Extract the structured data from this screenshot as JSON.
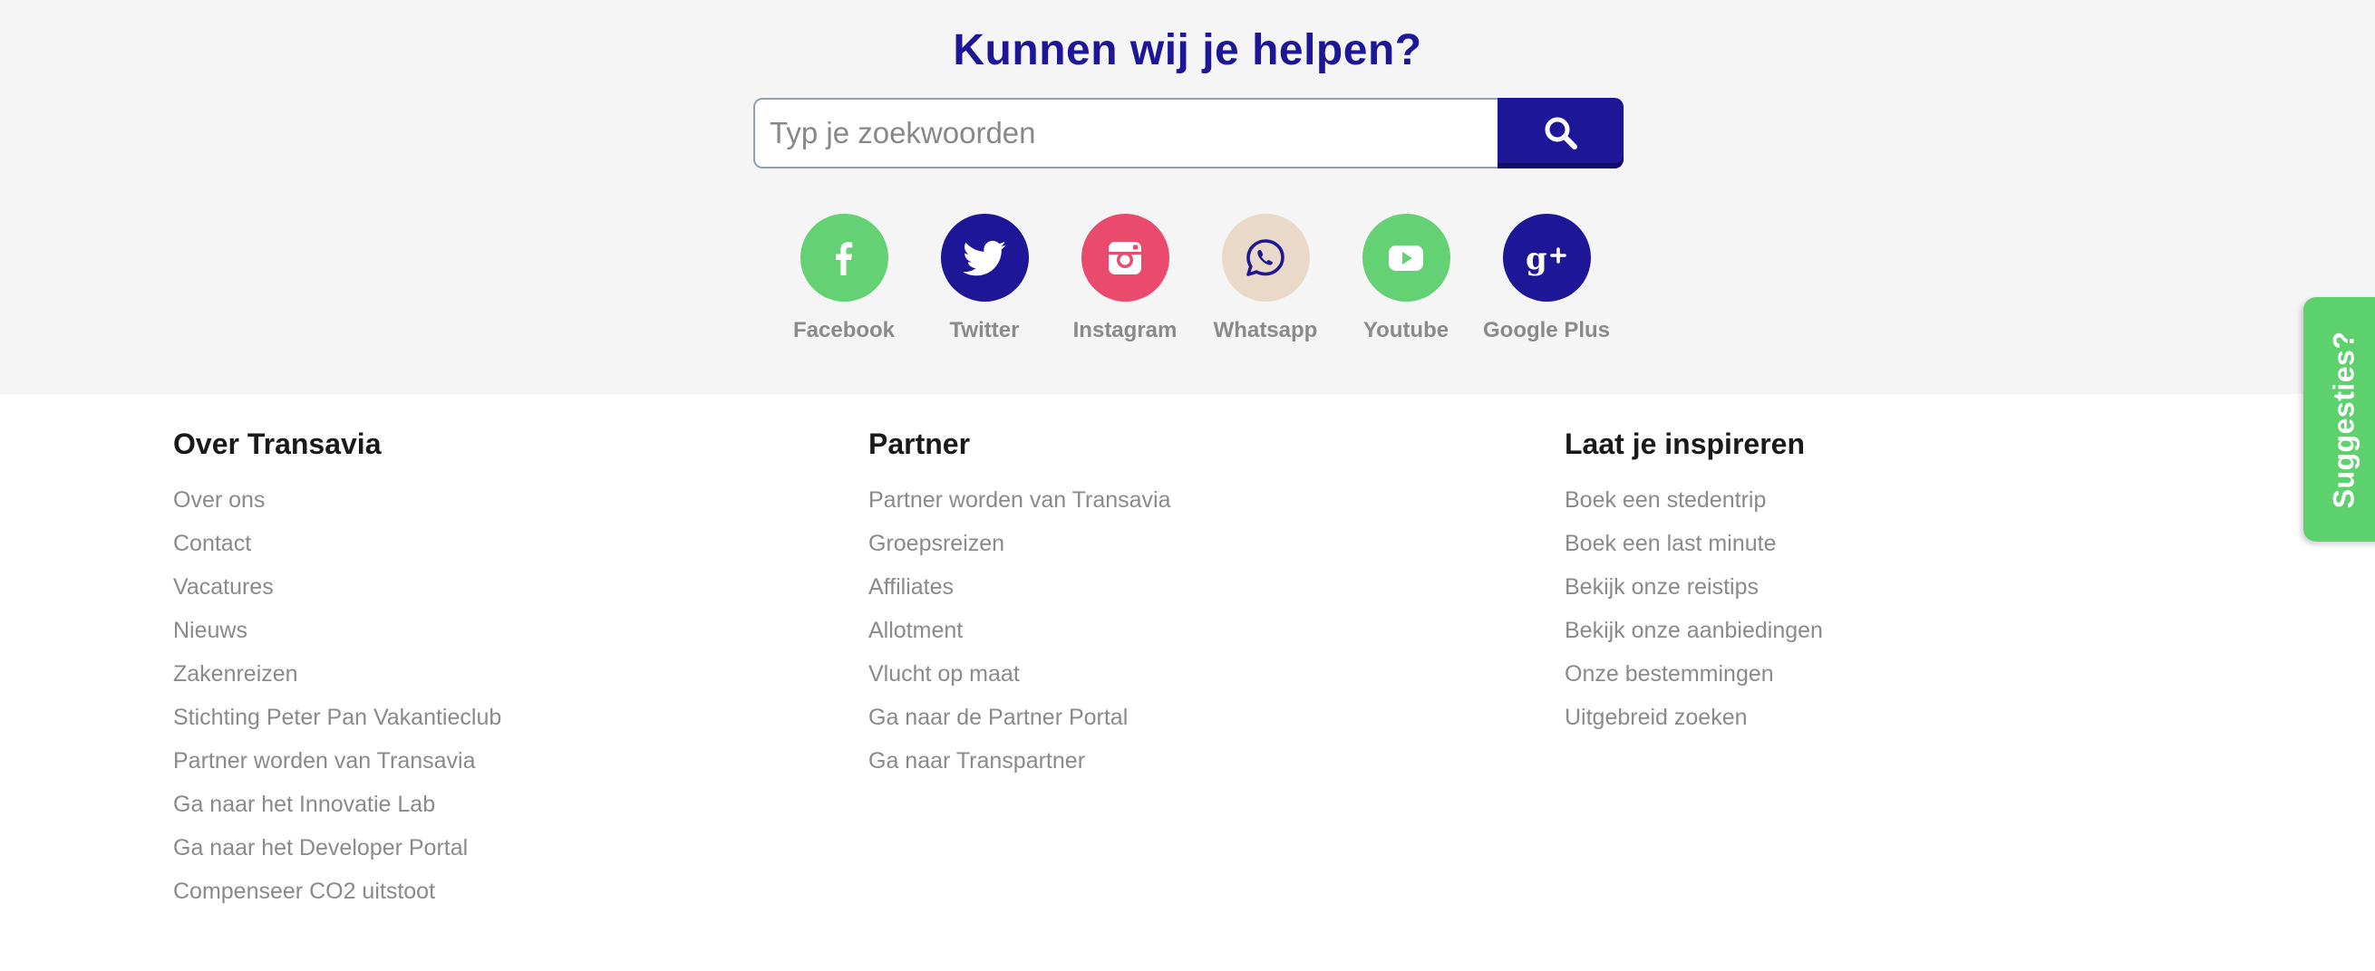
{
  "help": {
    "title": "Kunnen wij je helpen?",
    "search_placeholder": "Typ je zoekwoorden",
    "search_button_icon": "search-icon"
  },
  "social": [
    {
      "label": "Facebook",
      "icon": "facebook-icon",
      "color": "#63d174"
    },
    {
      "label": "Twitter",
      "icon": "twitter-icon",
      "color": "#1d1797"
    },
    {
      "label": "Instagram",
      "icon": "instagram-icon",
      "color": "#ea4a6b"
    },
    {
      "label": "Whatsapp",
      "icon": "whatsapp-icon",
      "color": "#ead9c9"
    },
    {
      "label": "Youtube",
      "icon": "youtube-icon",
      "color": "#63d174"
    },
    {
      "label": "Google Plus",
      "icon": "google-plus-icon",
      "color": "#1d1797"
    }
  ],
  "footer": {
    "columns": [
      {
        "heading": "Over Transavia",
        "links": [
          "Over ons",
          "Contact",
          "Vacatures",
          "Nieuws",
          "Zakenreizen",
          "Stichting Peter Pan Vakantieclub",
          "Partner worden van Transavia",
          "Ga naar het Innovatie Lab",
          "Ga naar het Developer Portal",
          "Compenseer CO2 uitstoot"
        ]
      },
      {
        "heading": "Partner",
        "links": [
          "Partner worden van Transavia",
          "Groepsreizen",
          "Affiliates",
          "Allotment",
          "Vlucht op maat",
          "Ga naar de Partner Portal",
          "Ga naar Transpartner"
        ]
      },
      {
        "heading": "Laat je inspireren",
        "links": [
          "Boek een stedentrip",
          "Boek een last minute",
          "Bekijk onze reistips",
          "Bekijk onze aanbiedingen",
          "Onze bestemmingen",
          "Uitgebreid zoeken"
        ]
      }
    ]
  },
  "suggestions_tab": {
    "label": "Suggesties?",
    "color": "#5dd16d"
  },
  "colors": {
    "brand_blue": "#1d1797",
    "link_gray": "#8a8a8a",
    "band_bg": "#f5f5f5"
  }
}
